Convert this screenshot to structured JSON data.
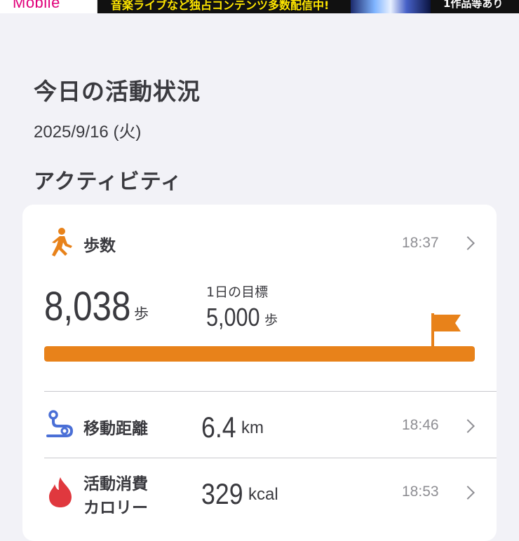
{
  "banner": {
    "brand": "Mobile",
    "text": "音楽ライブなど独占コンテンツ多数配信中!",
    "right_text": "1作品等あり"
  },
  "header": {
    "title": "今日の活動状況",
    "date": "2025/9/16 (火)"
  },
  "section": {
    "title": "アクティビティ"
  },
  "steps": {
    "label": "歩数",
    "time": "18:37",
    "value": "8,038",
    "unit": "歩",
    "goal_label": "1日の目標",
    "goal_value": "5,000",
    "goal_unit": "歩",
    "progress_fraction": 1.0,
    "icon": "walking-person-icon",
    "accent_color": "#E8821A"
  },
  "distance": {
    "label": "移動距離",
    "value": "6.4",
    "unit": "km",
    "time": "18:46",
    "icon": "route-icon",
    "icon_color": "#4A6FD6"
  },
  "calories": {
    "label_line1": "活動消費",
    "label_line2": "カロリー",
    "value": "329",
    "unit": "kcal",
    "time": "18:53",
    "icon": "flame-icon",
    "icon_color": "#E0383E"
  }
}
